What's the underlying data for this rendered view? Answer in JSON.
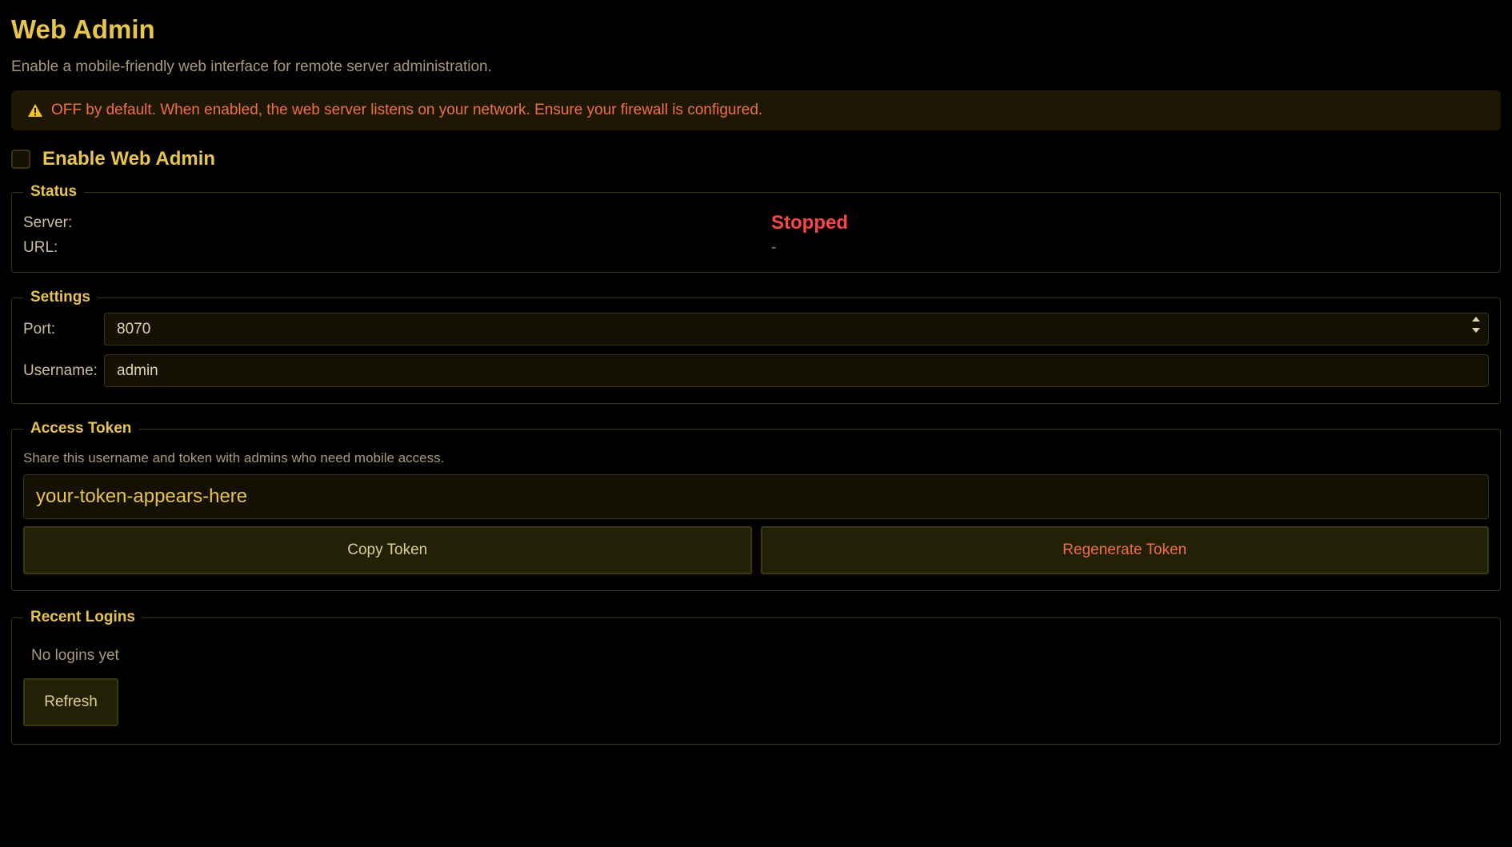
{
  "header": {
    "title": "Web Admin",
    "subtitle": "Enable a mobile-friendly web interface for remote server administration."
  },
  "warning": {
    "icon": "warning-icon",
    "text": "OFF by default. When enabled, the web server listens on your network. Ensure your firewall is configured."
  },
  "enable": {
    "label": "Enable Web Admin",
    "checked": false
  },
  "status": {
    "legend": "Status",
    "server_label": "Server:",
    "server_value": "Stopped",
    "url_label": "URL:",
    "url_value": "-"
  },
  "settings": {
    "legend": "Settings",
    "port_label": "Port:",
    "port_value": "8070",
    "username_label": "Username:",
    "username_value": "admin"
  },
  "token": {
    "legend": "Access Token",
    "description": "Share this username and token with admins who need mobile access.",
    "value": "your-token-appears-here",
    "copy_label": "Copy Token",
    "regenerate_label": "Regenerate Token"
  },
  "logins": {
    "legend": "Recent Logins",
    "empty_text": "No logins yet",
    "refresh_label": "Refresh"
  },
  "colors": {
    "accent": "#e8c547",
    "danger": "#ff4444",
    "warning_text": "#f07040",
    "background": "#000000"
  }
}
